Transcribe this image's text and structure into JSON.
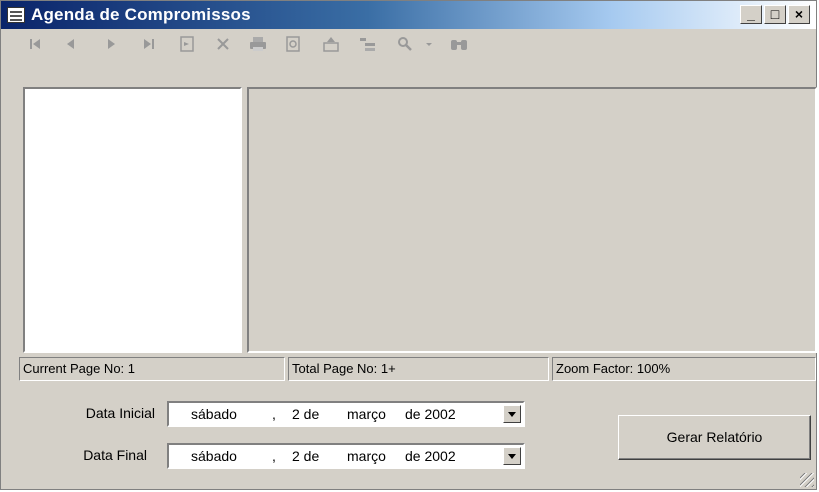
{
  "window": {
    "title": "Agenda de Compromissos"
  },
  "status": {
    "current_page": "Current Page No: 1",
    "total_page": "Total Page No: 1+",
    "zoom": "Zoom Factor: 100%"
  },
  "form": {
    "data_inicial_label": "Data Inicial",
    "data_final_label": "Data Final",
    "data_inicial": {
      "weekday": "sábado",
      "sep": ",",
      "day": "2 de",
      "month": "março",
      "year": "de 2002"
    },
    "data_final": {
      "weekday": "sábado",
      "sep": ",",
      "day": "2 de",
      "month": "março",
      "year": "de 2002"
    },
    "button_label": "Gerar Relatório"
  },
  "toolbar_icons": [
    "first-page-icon",
    "prev-page-icon",
    "next-page-icon",
    "last-page-icon",
    "goto-page-icon",
    "close-icon",
    "print-icon",
    "refresh-icon",
    "export-icon",
    "group-tree-icon",
    "zoom-icon",
    "dropdown-icon",
    "search-icon"
  ]
}
